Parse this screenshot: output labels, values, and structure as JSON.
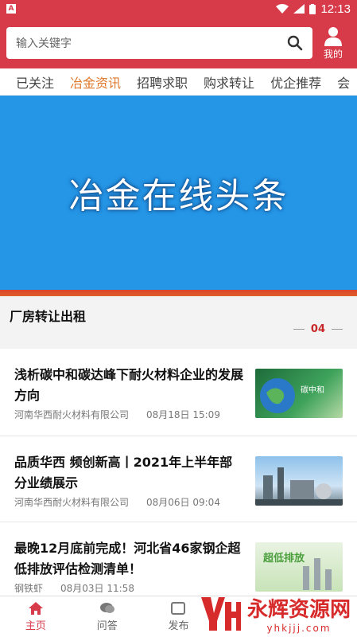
{
  "statusbar": {
    "time": "12:13",
    "badge": "A"
  },
  "header": {
    "search_placeholder": "输入关键字",
    "mine_label": "我的"
  },
  "tabs": [
    {
      "label": "已关注",
      "active": false
    },
    {
      "label": "冶金资讯",
      "active": true
    },
    {
      "label": "招聘求职",
      "active": false
    },
    {
      "label": "购求转让",
      "active": false
    },
    {
      "label": "优企推荐",
      "active": false
    },
    {
      "label": "会",
      "active": false
    }
  ],
  "banner": {
    "text": "冶金在线头条"
  },
  "section": {
    "title": "厂房转让出租",
    "page": "04"
  },
  "news": [
    {
      "headline": "浅析碳中和碳达峰下耐火材料企业的发展方向",
      "source": "河南华西耐火材料有限公司",
      "date": "08月18日 15:09",
      "thumb_label": "碳中和"
    },
    {
      "headline": "品质华西 频创新高丨2021年上半年部分业绩展示",
      "source": "河南华西耐火材料有限公司",
      "date": "08月06日 09:04",
      "thumb_label": ""
    },
    {
      "headline": "最晚12月底前完成！河北省46家钢企超低排放评估检测清单！",
      "source": "钢铁虾",
      "date": "08月03日 11:58",
      "thumb_label": "超低排放"
    }
  ],
  "bottomnav": [
    {
      "label": "主页",
      "icon": "home-icon",
      "active": true
    },
    {
      "label": "问答",
      "icon": "chat-icon",
      "active": false
    },
    {
      "label": "发布",
      "icon": "publish-icon",
      "active": false
    },
    {
      "label": "",
      "icon": "",
      "active": false
    },
    {
      "label": "",
      "icon": "",
      "active": false
    }
  ],
  "watermark": {
    "title": "永辉资源网",
    "url": "yhkjjj.com"
  },
  "colors": {
    "brand_red": "#d73a49",
    "tab_active": "#e0782b",
    "banner_blue": "#2596e6"
  }
}
